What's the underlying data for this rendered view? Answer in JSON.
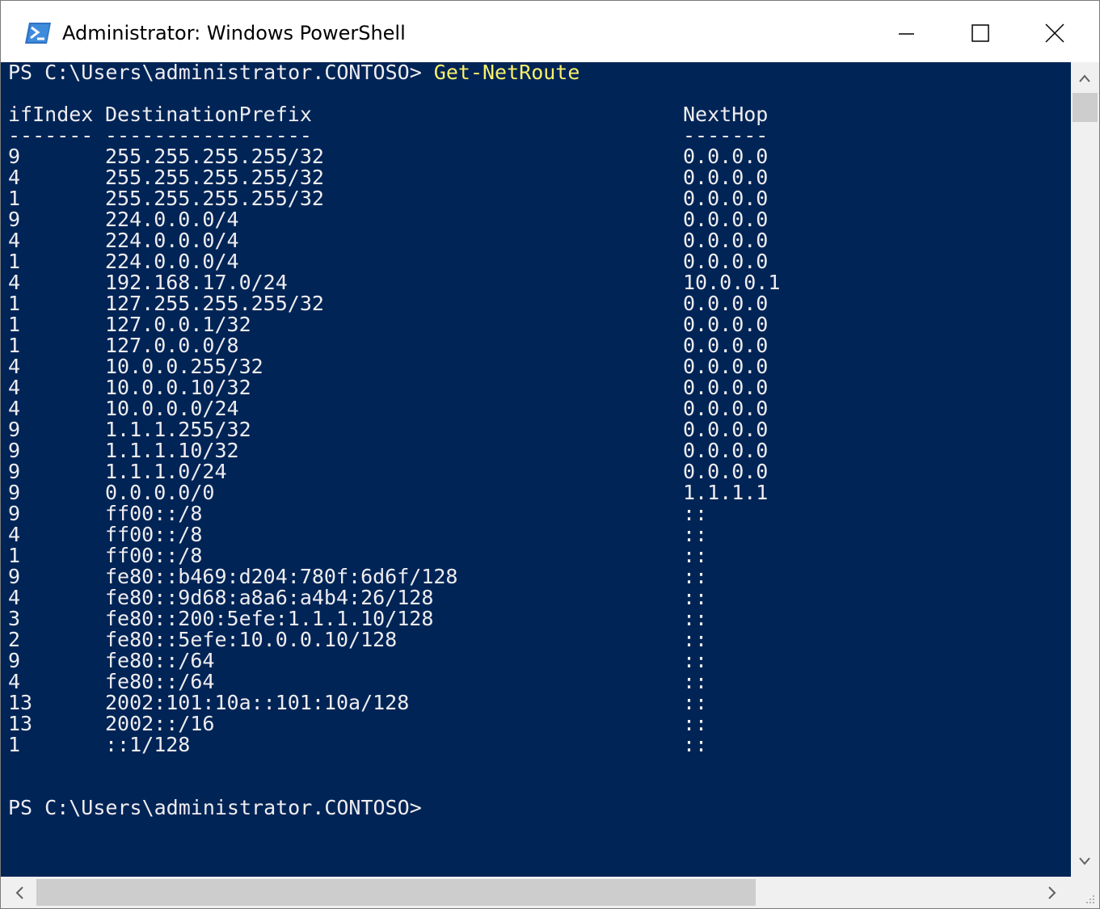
{
  "window": {
    "title": "Administrator: Windows PowerShell",
    "app_icon": "powershell-icon",
    "caption_buttons": [
      "minimize-icon",
      "maximize-icon",
      "close-icon"
    ]
  },
  "console": {
    "background": "#012456",
    "foreground": "#eeedf0",
    "command_color": "#f9f06a",
    "prompt": "PS C:\\Users\\administrator.CONTOSO> ",
    "command": "Get-NetRoute",
    "headers": {
      "ifindex": "ifIndex",
      "destination": "DestinationPrefix",
      "nexthop": "NextHop"
    },
    "separators": {
      "ifindex": "-------",
      "destination": "-----------------",
      "nexthop": "-------"
    },
    "rows": [
      {
        "ifindex": "9",
        "destination": "255.255.255.255/32",
        "nexthop": "0.0.0.0"
      },
      {
        "ifindex": "4",
        "destination": "255.255.255.255/32",
        "nexthop": "0.0.0.0"
      },
      {
        "ifindex": "1",
        "destination": "255.255.255.255/32",
        "nexthop": "0.0.0.0"
      },
      {
        "ifindex": "9",
        "destination": "224.0.0.0/4",
        "nexthop": "0.0.0.0"
      },
      {
        "ifindex": "4",
        "destination": "224.0.0.0/4",
        "nexthop": "0.0.0.0"
      },
      {
        "ifindex": "1",
        "destination": "224.0.0.0/4",
        "nexthop": "0.0.0.0"
      },
      {
        "ifindex": "4",
        "destination": "192.168.17.0/24",
        "nexthop": "10.0.0.1"
      },
      {
        "ifindex": "1",
        "destination": "127.255.255.255/32",
        "nexthop": "0.0.0.0"
      },
      {
        "ifindex": "1",
        "destination": "127.0.0.1/32",
        "nexthop": "0.0.0.0"
      },
      {
        "ifindex": "1",
        "destination": "127.0.0.0/8",
        "nexthop": "0.0.0.0"
      },
      {
        "ifindex": "4",
        "destination": "10.0.0.255/32",
        "nexthop": "0.0.0.0"
      },
      {
        "ifindex": "4",
        "destination": "10.0.0.10/32",
        "nexthop": "0.0.0.0"
      },
      {
        "ifindex": "4",
        "destination": "10.0.0.0/24",
        "nexthop": "0.0.0.0"
      },
      {
        "ifindex": "9",
        "destination": "1.1.1.255/32",
        "nexthop": "0.0.0.0"
      },
      {
        "ifindex": "9",
        "destination": "1.1.1.10/32",
        "nexthop": "0.0.0.0"
      },
      {
        "ifindex": "9",
        "destination": "1.1.1.0/24",
        "nexthop": "0.0.0.0"
      },
      {
        "ifindex": "9",
        "destination": "0.0.0.0/0",
        "nexthop": "1.1.1.1"
      },
      {
        "ifindex": "9",
        "destination": "ff00::/8",
        "nexthop": "::"
      },
      {
        "ifindex": "4",
        "destination": "ff00::/8",
        "nexthop": "::"
      },
      {
        "ifindex": "1",
        "destination": "ff00::/8",
        "nexthop": "::"
      },
      {
        "ifindex": "9",
        "destination": "fe80::b469:d204:780f:6d6f/128",
        "nexthop": "::"
      },
      {
        "ifindex": "4",
        "destination": "fe80::9d68:a8a6:a4b4:26/128",
        "nexthop": "::"
      },
      {
        "ifindex": "3",
        "destination": "fe80::200:5efe:1.1.1.10/128",
        "nexthop": "::"
      },
      {
        "ifindex": "2",
        "destination": "fe80::5efe:10.0.0.10/128",
        "nexthop": "::"
      },
      {
        "ifindex": "9",
        "destination": "fe80::/64",
        "nexthop": "::"
      },
      {
        "ifindex": "4",
        "destination": "fe80::/64",
        "nexthop": "::"
      },
      {
        "ifindex": "13",
        "destination": "2002:101:10a::101:10a/128",
        "nexthop": "::"
      },
      {
        "ifindex": "13",
        "destination": "2002::/16",
        "nexthop": "::"
      },
      {
        "ifindex": "1",
        "destination": "::1/128",
        "nexthop": "::"
      }
    ],
    "final_prompt": "PS C:\\Users\\administrator.CONTOSO>"
  },
  "scrollbars": {
    "vertical": {
      "up_icon": "chevron-up-icon",
      "down_icon": "chevron-down-icon"
    },
    "horizontal": {
      "left_icon": "chevron-left-icon",
      "right_icon": "chevron-right-icon"
    }
  }
}
